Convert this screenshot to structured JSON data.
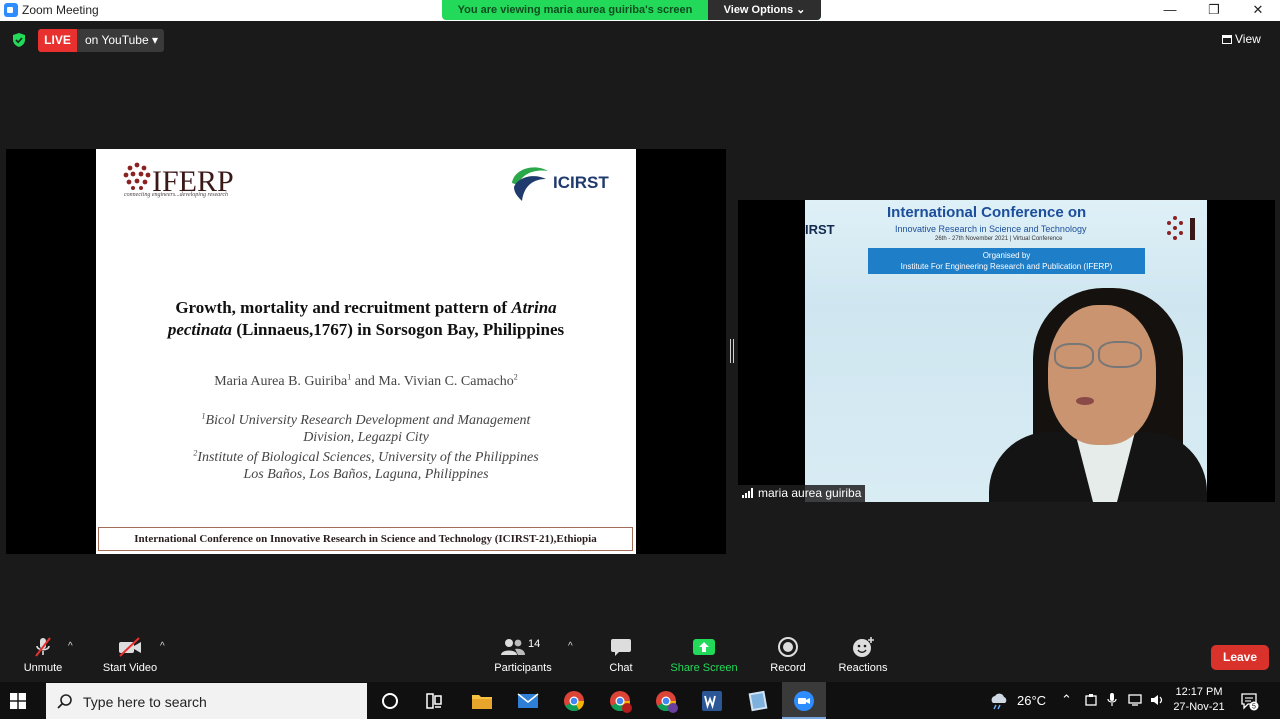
{
  "window": {
    "title": "Zoom Meeting",
    "minimize": "—",
    "restore": "❐",
    "close": "✕"
  },
  "banner": {
    "viewing_text": "You are viewing maria aurea guiriba's screen",
    "view_options": "View Options ⌄"
  },
  "live": {
    "badge": "LIVE",
    "destination": "on YouTube ▾"
  },
  "view_button": "View",
  "slide": {
    "logo_left": "IFERP",
    "logo_left_tagline": "connecting engineers...developing research",
    "logo_right": "ICIRST",
    "title_a": "Growth, mortality and recruitment pattern of ",
    "title_italic_a": "Atrina",
    "title_italic_b": "pectinata",
    "title_b": " (Linnaeus,1767) in Sorsogon Bay, Philippines",
    "author1": "Maria Aurea B. Guiriba",
    "author_sup1": "1",
    "author_and": " and Ma. Vivian C. Camacho",
    "author_sup2": "2",
    "aff1_sup": "1",
    "aff1_line1": "Bicol University Research Development and Management",
    "aff1_line2": "Division, Legazpi City",
    "aff2_sup": "2",
    "aff2_line1": "Institute of Biological Sciences, University of the Philippines",
    "aff2_line2": "Los Baños, Los Baños, Laguna, Philippines",
    "footer": "International Conference on Innovative Research in Science and Technology (ICIRST-21),Ethiopia"
  },
  "video": {
    "conf_title": "International Conference on",
    "conf_sub": "Innovative Research in Science and Technology",
    "conf_date": "26th - 27th November 2021 | Virtual Conference",
    "organised_by": "Organised by",
    "organiser": "Institute For Engineering Research and Publication (IFERP)",
    "icirst": "IRST",
    "participant_name": "maria aurea guiriba"
  },
  "toolbar": {
    "unmute": "Unmute",
    "start_video": "Start Video",
    "participants": "Participants",
    "participants_count": "14",
    "chat": "Chat",
    "share_screen": "Share Screen",
    "record": "Record",
    "reactions": "Reactions",
    "leave": "Leave",
    "caret": "^"
  },
  "taskbar": {
    "search_placeholder": "Type here to search",
    "temperature": "26°C",
    "time": "12:17 PM",
    "date": "27-Nov-21",
    "notification_count": "5"
  },
  "colors": {
    "zoom_green": "#23d959",
    "live_red": "#e8312f",
    "leave_red": "#d9322b",
    "zoom_blue": "#2d8cff"
  }
}
